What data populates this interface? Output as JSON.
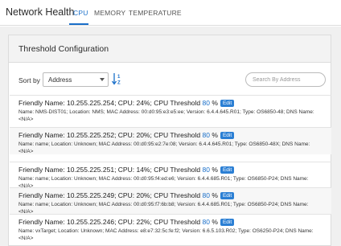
{
  "header": {
    "title": "Network Health",
    "tabs": [
      {
        "label": "CPU",
        "active": true
      },
      {
        "label": "MEMORY",
        "active": false
      },
      {
        "label": "TEMPERATURE",
        "active": false
      }
    ]
  },
  "panel": {
    "title": "Threshold Configuration",
    "sort_label": "Sort by",
    "sort_value": "Address",
    "search_placeholder": "Search By Address"
  },
  "devices": [
    {
      "title_prefix": "Friendly Name: 10.255.225.254; CPU: 24%; CPU Threshold",
      "threshold": "80",
      "unit": "%",
      "edit": "Edit",
      "details": "Name: NMS-DIST01; Location: NMS; MAC Address: 00:d0:95:e3:e5:ee; Version: 6.4.4.645.R01; Type: OS6850-48; DNS Name: <N/A>"
    },
    {
      "title_prefix": "Friendly Name: 10.255.225.252; CPU: 20%; CPU Threshold",
      "threshold": "80",
      "unit": "%",
      "edit": "Edit",
      "details": "Name: name; Location: Unknown; MAC Address: 00:d0:95:e2:7e:08; Version: 6.4.4.645.R01; Type: OS6850-48X; DNS Name: <N/A>"
    },
    {
      "title_prefix": "Friendly Name: 10.255.225.251; CPU: 14%; CPU Threshold",
      "threshold": "80",
      "unit": "%",
      "edit": "Edit",
      "details": "Name: name; Location: Unknown; MAC Address: 00:d0:95:f4:ed:e6; Version: 6.4.4.685.R01; Type: OS6850-P24; DNS Name: <N/A>"
    },
    {
      "title_prefix": "Friendly Name: 10.255.225.249; CPU: 20%; CPU Threshold",
      "threshold": "80",
      "unit": "%",
      "edit": "Edit",
      "details": "Name: name; Location: Unknown; MAC Address: 00:d0:95:f7:6b:b8; Version: 6.4.4.685.R01; Type: OS6850-P24; DNS Name: <N/A>"
    },
    {
      "title_prefix": "Friendly Name: 10.255.225.246; CPU: 22%; CPU Threshold",
      "threshold": "80",
      "unit": "%",
      "edit": "Edit",
      "details": "Name: vxTarget; Location: Unknown; MAC Address: e8:e7:32:5c:fe:f2; Version: 6.6.5.103.R02; Type: OS6250-P24; DNS Name: <N/A>"
    }
  ]
}
